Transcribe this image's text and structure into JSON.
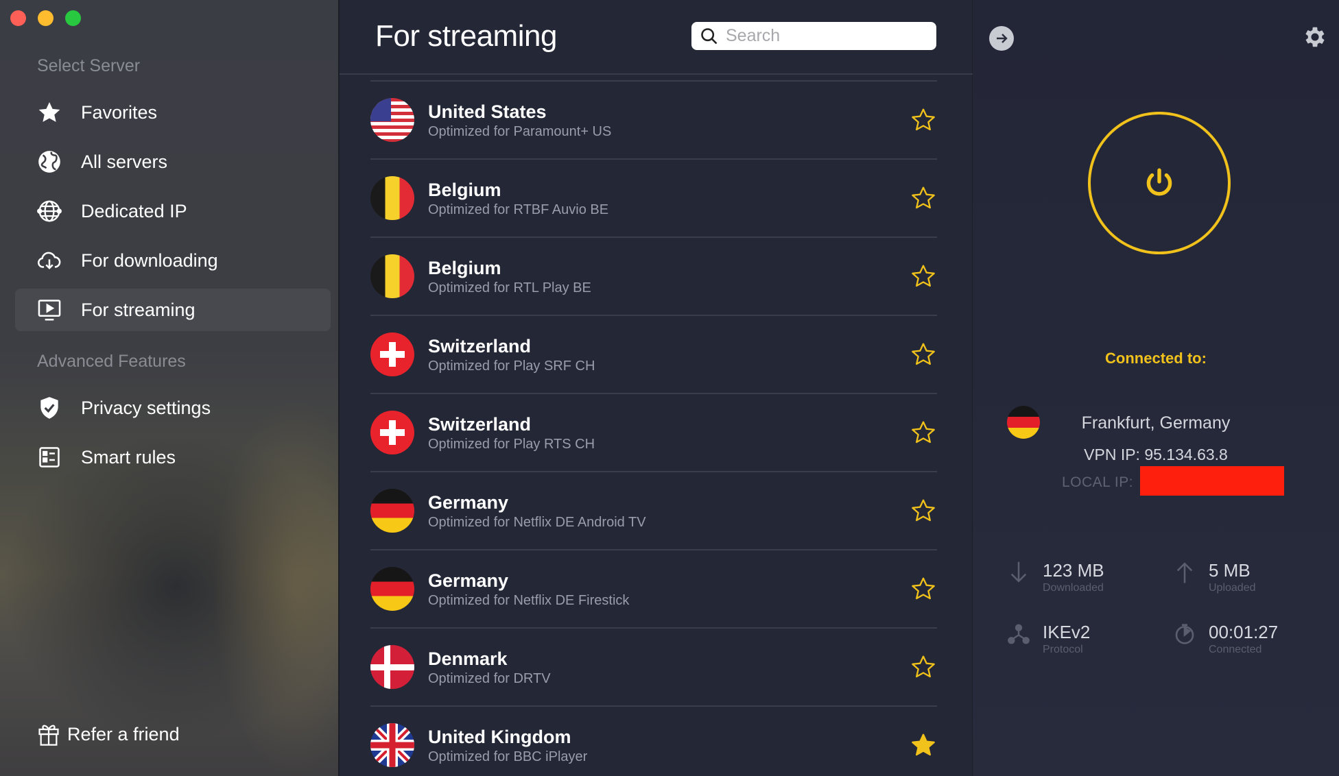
{
  "sidebar": {
    "section_select": "Select Server",
    "items": [
      {
        "label": "Favorites",
        "icon": "star-icon"
      },
      {
        "label": "All servers",
        "icon": "globe-icon"
      },
      {
        "label": "Dedicated IP",
        "icon": "globe-network-icon"
      },
      {
        "label": "For downloading",
        "icon": "cloud-download-icon"
      },
      {
        "label": "For streaming",
        "icon": "monitor-play-icon",
        "active": true
      }
    ],
    "section_advanced": "Advanced Features",
    "advanced_items": [
      {
        "label": "Privacy settings",
        "icon": "shield-check-icon"
      },
      {
        "label": "Smart rules",
        "icon": "rules-list-icon"
      }
    ],
    "refer": "Refer a friend"
  },
  "list": {
    "title": "For streaming",
    "search_placeholder": "Search",
    "rows": [
      {
        "country": "United States",
        "sub": "Optimized for Paramount+ US",
        "flag": "us",
        "favorite": false
      },
      {
        "country": "Belgium",
        "sub": "Optimized for RTBF Auvio BE",
        "flag": "be",
        "favorite": false
      },
      {
        "country": "Belgium",
        "sub": "Optimized for RTL Play BE",
        "flag": "be",
        "favorite": false
      },
      {
        "country": "Switzerland",
        "sub": "Optimized for Play SRF CH",
        "flag": "ch",
        "favorite": false
      },
      {
        "country": "Switzerland",
        "sub": "Optimized for Play RTS CH",
        "flag": "ch",
        "favorite": false
      },
      {
        "country": "Germany",
        "sub": "Optimized for Netflix DE Android TV",
        "flag": "de",
        "favorite": false
      },
      {
        "country": "Germany",
        "sub": "Optimized for Netflix DE Firestick",
        "flag": "de",
        "favorite": false
      },
      {
        "country": "Denmark",
        "sub": "Optimized for DRTV",
        "flag": "dk",
        "favorite": false
      },
      {
        "country": "United Kingdom",
        "sub": "Optimized for BBC iPlayer",
        "flag": "uk",
        "favorite": true
      }
    ]
  },
  "status": {
    "connected_label": "Connected to:",
    "location": "Frankfurt, Germany",
    "vpn_ip": "VPN IP: 95.134.63.8",
    "local_ip_label": "LOCAL IP:",
    "downloaded_value": "123 MB",
    "downloaded_label": "Downloaded",
    "uploaded_value": "5 MB",
    "uploaded_label": "Uploaded",
    "protocol_value": "IKEv2",
    "protocol_label": "Protocol",
    "time_value": "00:01:27",
    "time_label": "Connected"
  },
  "colors": {
    "accent": "#f1c21b",
    "sidebar_bg": "#3d3e44",
    "list_bg": "#242735",
    "redaction": "#ff1f0d"
  }
}
